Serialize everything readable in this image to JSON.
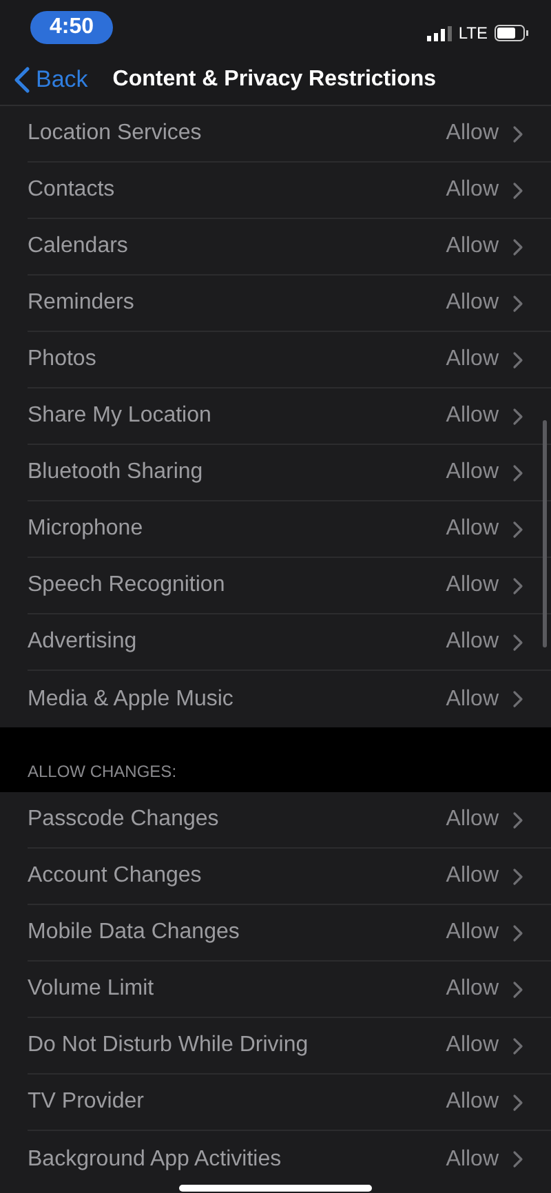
{
  "status_bar": {
    "time": "4:50",
    "network": "LTE"
  },
  "nav": {
    "back": "Back",
    "title": "Content & Privacy Restrictions"
  },
  "sections": [
    {
      "rows": [
        {
          "label": "Location Services",
          "value": "Allow"
        },
        {
          "label": "Contacts",
          "value": "Allow"
        },
        {
          "label": "Calendars",
          "value": "Allow"
        },
        {
          "label": "Reminders",
          "value": "Allow"
        },
        {
          "label": "Photos",
          "value": "Allow"
        },
        {
          "label": "Share My Location",
          "value": "Allow"
        },
        {
          "label": "Bluetooth Sharing",
          "value": "Allow"
        },
        {
          "label": "Microphone",
          "value": "Allow"
        },
        {
          "label": "Speech Recognition",
          "value": "Allow"
        },
        {
          "label": "Advertising",
          "value": "Allow"
        },
        {
          "label": "Media & Apple Music",
          "value": "Allow"
        }
      ]
    },
    {
      "header": "ALLOW CHANGES:",
      "rows": [
        {
          "label": "Passcode Changes",
          "value": "Allow"
        },
        {
          "label": "Account Changes",
          "value": "Allow"
        },
        {
          "label": "Mobile Data Changes",
          "value": "Allow"
        },
        {
          "label": "Volume Limit",
          "value": "Allow"
        },
        {
          "label": "Do Not Disturb While Driving",
          "value": "Allow"
        },
        {
          "label": "TV Provider",
          "value": "Allow"
        },
        {
          "label": "Background App Activities",
          "value": "Allow"
        }
      ]
    }
  ]
}
